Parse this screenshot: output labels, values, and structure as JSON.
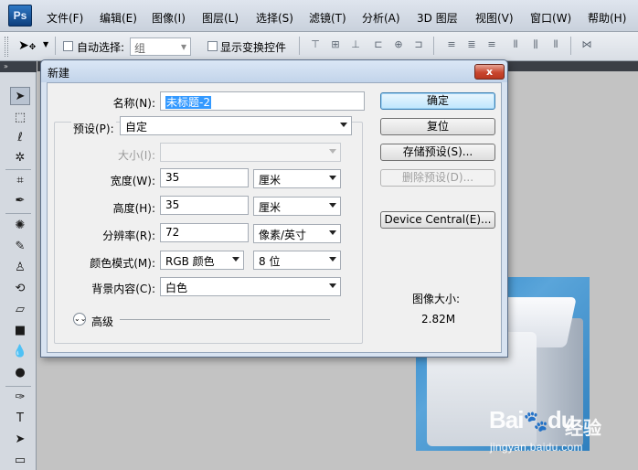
{
  "app": {
    "logo": "Ps"
  },
  "menu": [
    "文件(F)",
    "编辑(E)",
    "图像(I)",
    "图层(L)",
    "选择(S)",
    "滤镜(T)",
    "分析(A)",
    "3D 图层",
    "视图(V)",
    "窗口(W)",
    "帮助(H)"
  ],
  "options": {
    "tool_icon": "move-tool-icon",
    "auto_select_label": "自动选择:",
    "auto_select_checked": false,
    "auto_select_value": "组",
    "show_transform_label": "显示变换控件",
    "show_transform_checked": false
  },
  "tools": [
    "move-tool-icon",
    "marquee-tool-icon",
    "lasso-tool-icon",
    "magic-wand-icon",
    "crop-tool-icon",
    "eyedropper-icon",
    "healing-brush-icon",
    "brush-tool-icon",
    "clone-stamp-icon",
    "history-brush-icon",
    "eraser-icon",
    "gradient-icon",
    "blur-tool-icon",
    "dodge-tool-icon",
    "pen-tool-icon",
    "type-tool-icon",
    "path-select-icon",
    "shape-tool-icon"
  ],
  "dialog": {
    "title": "新建",
    "close_glyph": "x",
    "name_label": "名称(N):",
    "name_value": "未标题-2",
    "preset_label": "预设(P):",
    "preset_value": "自定",
    "size_label": "大小(I):",
    "size_value": "",
    "width_label": "宽度(W):",
    "width_value": "35",
    "width_unit": "厘米",
    "height_label": "高度(H):",
    "height_value": "35",
    "height_unit": "厘米",
    "resolution_label": "分辨率(R):",
    "resolution_value": "72",
    "resolution_unit": "像素/英寸",
    "color_mode_label": "颜色模式(M):",
    "color_mode_value": "RGB 颜色",
    "bit_depth_value": "8 位",
    "background_label": "背景内容(C):",
    "background_value": "白色",
    "advanced_label": "高级",
    "buttons": {
      "ok": "确定",
      "reset": "复位",
      "save_preset": "存储预设(S)...",
      "delete_preset": "删除预设(D)...",
      "device_central": "Device Central(E)..."
    },
    "image_size_label": "图像大小:",
    "image_size_value": "2.82M"
  },
  "watermark": {
    "logo_text": "Bai",
    "logo_suffix": "du",
    "product": "经验",
    "url": "jingyan.baidu.com"
  }
}
